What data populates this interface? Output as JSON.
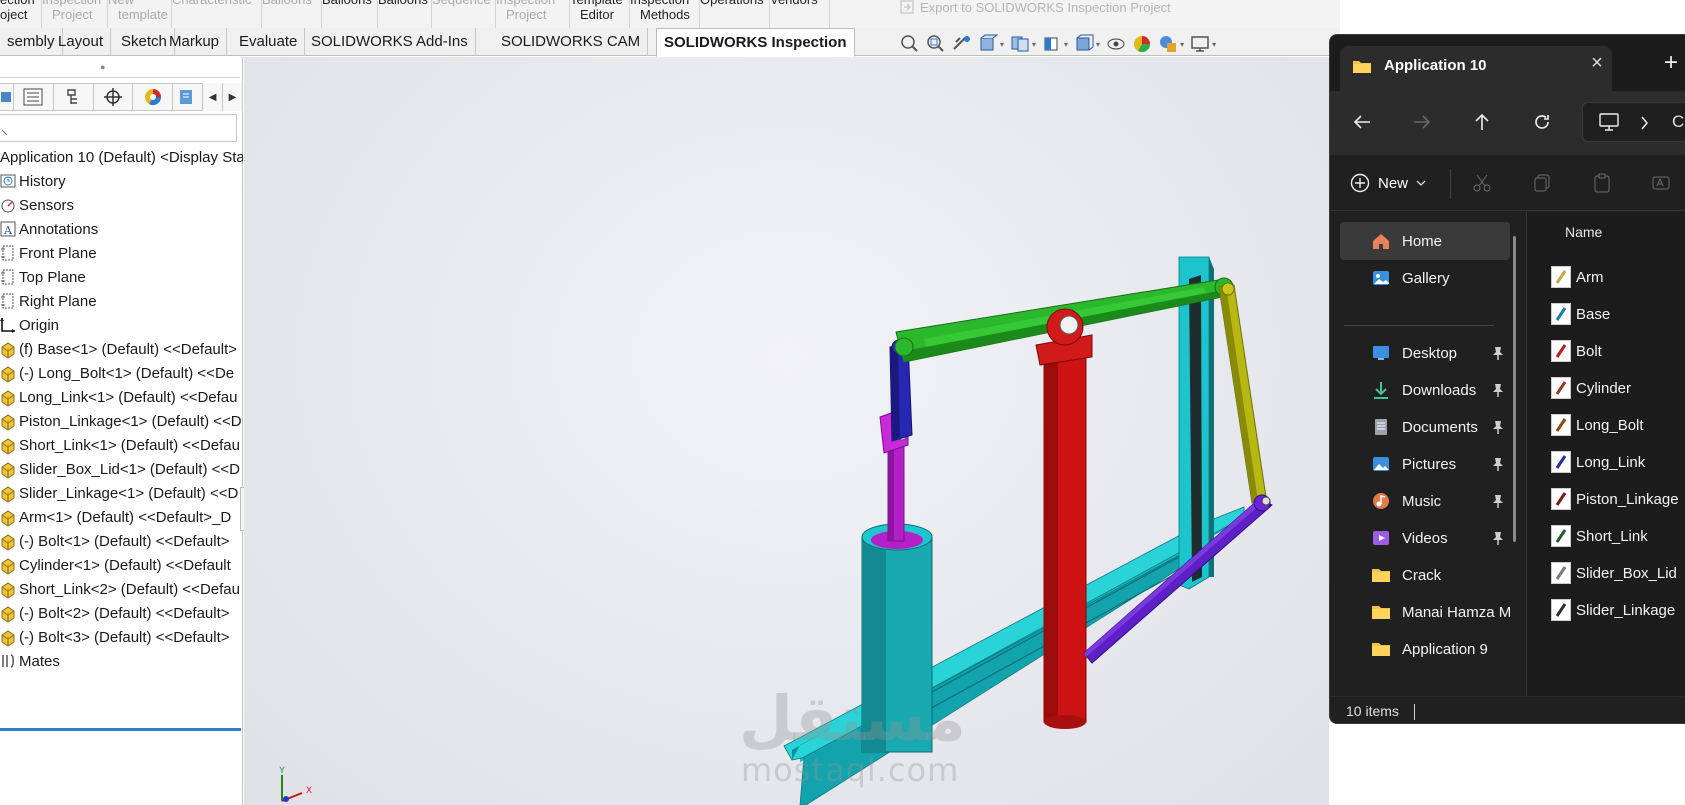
{
  "ribbon": {
    "groups": [
      {
        "l1": "ection",
        "l2": "oject",
        "dark": true
      },
      {
        "l1": "Inspection",
        "l2": "Project",
        "dark": false
      },
      {
        "l1": "New",
        "l2": "template",
        "dark": false
      },
      {
        "l1": "Characteristic",
        "l2": "",
        "dark": false
      },
      {
        "l1": "Balloons",
        "l2": "",
        "dark": false
      },
      {
        "l1": "Balloons",
        "l2": "",
        "dark": true
      },
      {
        "l1": "Balloons",
        "l2": "",
        "dark": true
      },
      {
        "l1": "Sequence",
        "l2": "",
        "dark": false
      },
      {
        "l1": "Inspection",
        "l2": "Project",
        "dark": false
      },
      {
        "l1": "Template",
        "l2": "Editor",
        "dark": true
      },
      {
        "l1": "Inspection",
        "l2": "Methods",
        "dark": true
      },
      {
        "l1": "Operations",
        "l2": "",
        "dark": true
      },
      {
        "l1": "Vendors",
        "l2": "",
        "dark": true
      }
    ],
    "export_label": "Export to SOLIDWORKS Inspection Project"
  },
  "tabs": [
    {
      "label": "sembly",
      "active": false
    },
    {
      "label": "Layout",
      "active": false
    },
    {
      "label": "Sketch",
      "active": false
    },
    {
      "label": "Markup",
      "active": false
    },
    {
      "label": "Evaluate",
      "active": false
    },
    {
      "label": "SOLIDWORKS Add-Ins",
      "active": false
    },
    {
      "label": "SOLIDWORKS CAM",
      "active": false
    },
    {
      "label": "SOLIDWORKS Inspection",
      "active": true
    }
  ],
  "heads_up_toolbar": [
    "zoom-to-fit-icon",
    "zoom-to-area-icon",
    "previous-view-icon",
    "section-view-icon",
    "dynamic-annotation-icon",
    "view-orientation-icon",
    "display-style-icon",
    "hide-show-icon",
    "edit-appearance-icon",
    "apply-scene-icon",
    "view-settings-icon"
  ],
  "feature_manager": {
    "filter_text": "",
    "root": "Application 10 (Default) <Display Sta",
    "items": [
      {
        "label": "History",
        "icon": "history-icon"
      },
      {
        "label": "Sensors",
        "icon": "sensors-icon"
      },
      {
        "label": "Annotations",
        "icon": "annotations-icon"
      },
      {
        "label": "Front Plane",
        "icon": "plane-icon"
      },
      {
        "label": "Top Plane",
        "icon": "plane-icon"
      },
      {
        "label": "Right Plane",
        "icon": "plane-icon"
      },
      {
        "label": "Origin",
        "icon": "origin-icon"
      },
      {
        "label": "(f) Base<1> (Default) <<Default>",
        "icon": "part-icon"
      },
      {
        "label": "(-) Long_Bolt<1> (Default) <<De",
        "icon": "part-icon"
      },
      {
        "label": "Long_Link<1> (Default) <<Defau",
        "icon": "part-icon"
      },
      {
        "label": "Piston_Linkage<1> (Default) <<D",
        "icon": "part-icon"
      },
      {
        "label": "Short_Link<1> (Default) <<Defau",
        "icon": "part-icon"
      },
      {
        "label": "Slider_Box_Lid<1> (Default) <<D",
        "icon": "part-icon"
      },
      {
        "label": "Slider_Linkage<1> (Default) <<D",
        "icon": "part-icon"
      },
      {
        "label": "Arm<1> (Default) <<Default>_D",
        "icon": "part-icon"
      },
      {
        "label": "(-) Bolt<1> (Default) <<Default>",
        "icon": "part-icon"
      },
      {
        "label": "Cylinder<1> (Default) <<Default",
        "icon": "part-icon"
      },
      {
        "label": "Short_Link<2> (Default) <<Defau",
        "icon": "part-icon"
      },
      {
        "label": "(-) Bolt<2> (Default) <<Default>",
        "icon": "part-icon"
      },
      {
        "label": "(-) Bolt<3> (Default) <<Default>",
        "icon": "part-icon"
      },
      {
        "label": "Mates",
        "icon": "mates-icon"
      }
    ]
  },
  "viewport": {
    "watermark_ar": "مستقل",
    "watermark_en": "mostaql.com",
    "triad": {
      "y": "Y",
      "x": "X"
    }
  },
  "explorer": {
    "tab_title": "Application 10",
    "new_label": "New",
    "address_partial": "C",
    "nav_items": [
      {
        "label": "Home",
        "icon": "home-icon",
        "pinned": false,
        "selected": true
      },
      {
        "label": "Gallery",
        "icon": "gallery-icon",
        "pinned": false,
        "selected": false
      },
      {
        "label": "Desktop",
        "icon": "desktop-icon",
        "pinned": true,
        "selected": false
      },
      {
        "label": "Downloads",
        "icon": "downloads-icon",
        "pinned": true,
        "selected": false
      },
      {
        "label": "Documents",
        "icon": "documents-icon",
        "pinned": true,
        "selected": false
      },
      {
        "label": "Pictures",
        "icon": "pictures-icon",
        "pinned": true,
        "selected": false
      },
      {
        "label": "Music",
        "icon": "music-icon",
        "pinned": true,
        "selected": false
      },
      {
        "label": "Videos",
        "icon": "videos-icon",
        "pinned": true,
        "selected": false
      },
      {
        "label": "Crack",
        "icon": "folder-icon",
        "pinned": false,
        "selected": false
      },
      {
        "label": "Manai Hamza M",
        "icon": "folder-icon",
        "pinned": false,
        "selected": false
      },
      {
        "label": "Application 9",
        "icon": "folder-icon",
        "pinned": false,
        "selected": false
      }
    ],
    "column_header": "Name",
    "files": [
      {
        "label": "Arm",
        "color": "#c9a24a"
      },
      {
        "label": "Base",
        "color": "#1a7fa0"
      },
      {
        "label": "Bolt",
        "color": "#b02020"
      },
      {
        "label": "Cylinder",
        "color": "#9a3a20"
      },
      {
        "label": "Long_Bolt",
        "color": "#8a4a18"
      },
      {
        "label": "Long_Link",
        "color": "#2a2a9a"
      },
      {
        "label": "Piston_Linkage",
        "color": "#7a1a1a"
      },
      {
        "label": "Short_Link",
        "color": "#2a5a2a"
      },
      {
        "label": "Slider_Box_Lid",
        "color": "#7a7a7a"
      },
      {
        "label": "Slider_Linkage",
        "color": "#303030"
      }
    ],
    "status_count": "10 items"
  },
  "colors": {
    "base": "#1fc6c6",
    "cylinder": "#2aa7a7",
    "piston": "#b51fc7",
    "arm": "#2cb82c",
    "post": "#d11616",
    "long_link": "#2a2ab8",
    "short_link": "#b8b812",
    "slider_linkage": "#5e1fc7"
  }
}
